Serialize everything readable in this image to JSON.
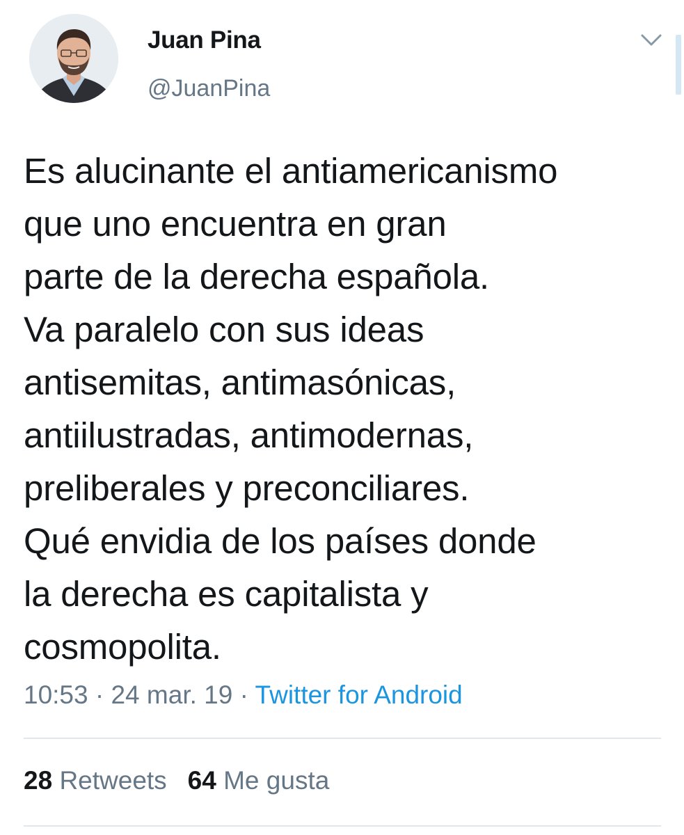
{
  "user": {
    "name": "Juan Pina",
    "handle": "@JuanPina"
  },
  "tweet": {
    "lines": [
      "Es alucinante el antiamericanismo",
      "que uno encuentra en gran",
      "parte de la derecha española.",
      "Va paralelo con sus ideas",
      "antisemitas, antimasónicas,",
      "antiilustradas, antimodernas,",
      "preliberales y preconciliares.",
      "Qué envidia de los países donde",
      "la derecha es capitalista y",
      "cosmopolita."
    ],
    "time": "10:53",
    "separator": " · ",
    "date": "24 mar. 19",
    "source": "Twitter for Android"
  },
  "stats": {
    "retweets_count": "28",
    "retweets_label": "Retweets",
    "likes_count": "64",
    "likes_label": "Me gusta"
  },
  "icons": {
    "menu": "chevron-down-icon",
    "avatar": "avatar"
  },
  "colors": {
    "text": "#14171a",
    "secondary": "#657786",
    "link": "#1b95e0",
    "divider": "#e1e8ed"
  }
}
